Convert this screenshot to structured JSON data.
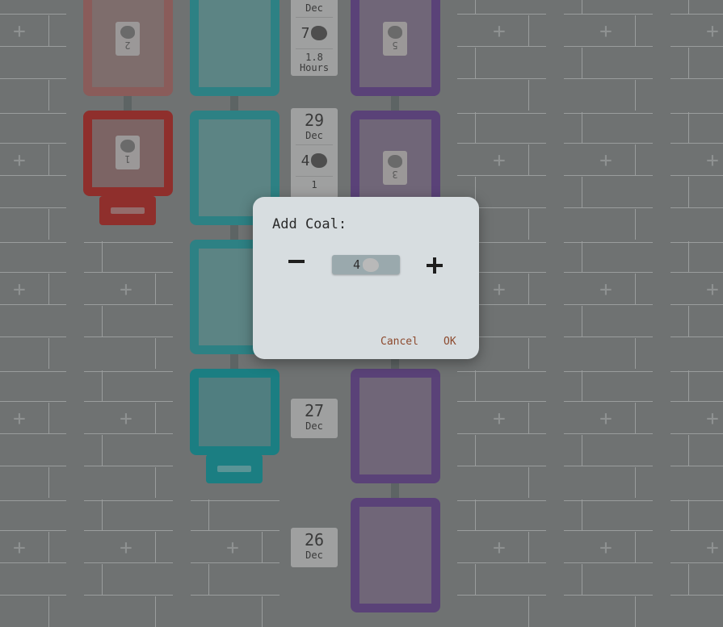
{
  "dialog": {
    "title": "Add Coal:",
    "value": "4",
    "cancel_label": "Cancel",
    "ok_label": "OK"
  },
  "red_column": {
    "badges": [
      "2",
      "1"
    ]
  },
  "purple_column": {
    "badges": [
      "5",
      "3"
    ]
  },
  "dates": [
    {
      "day": "",
      "month": "Dec",
      "coal": "7",
      "hours": "1.8 Hours"
    },
    {
      "day": "29",
      "month": "Dec",
      "coal": "4",
      "hours": "1"
    },
    {
      "day": "27",
      "month": "Dec"
    },
    {
      "day": "26",
      "month": "Dec"
    }
  ],
  "grid_plus": "+",
  "colors": {
    "red": "#8f2f2c",
    "teal": "#1b7e82",
    "purple": "#5a4278",
    "dialog": "#d7dde0",
    "action": "#8d4a2e"
  }
}
